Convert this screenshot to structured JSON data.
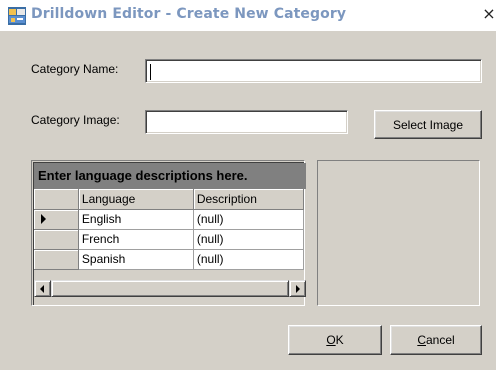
{
  "window": {
    "title": "Drilldown Editor - Create New Category",
    "close_label": "×"
  },
  "form": {
    "category_name_label": "Category Name:",
    "category_name_value": "",
    "category_image_label": "Category Image:",
    "category_image_value": "",
    "select_image_label": "Select Image"
  },
  "grid": {
    "caption": "Enter language descriptions here.",
    "columns": [
      "Language",
      "Description"
    ],
    "rows": [
      {
        "language": "English",
        "description": "(null)",
        "current": true
      },
      {
        "language": "French",
        "description": "(null)",
        "current": false
      },
      {
        "language": "Spanish",
        "description": "(null)",
        "current": false
      }
    ]
  },
  "buttons": {
    "ok_accel": "O",
    "ok_rest": "K",
    "cancel_accel": "C",
    "cancel_rest": "ancel"
  },
  "icons": {
    "title_icon": "app-icon",
    "row_indicator": "current-row-arrow-icon",
    "scroll_left": "scroll-left-icon",
    "scroll_right": "scroll-right-icon"
  }
}
